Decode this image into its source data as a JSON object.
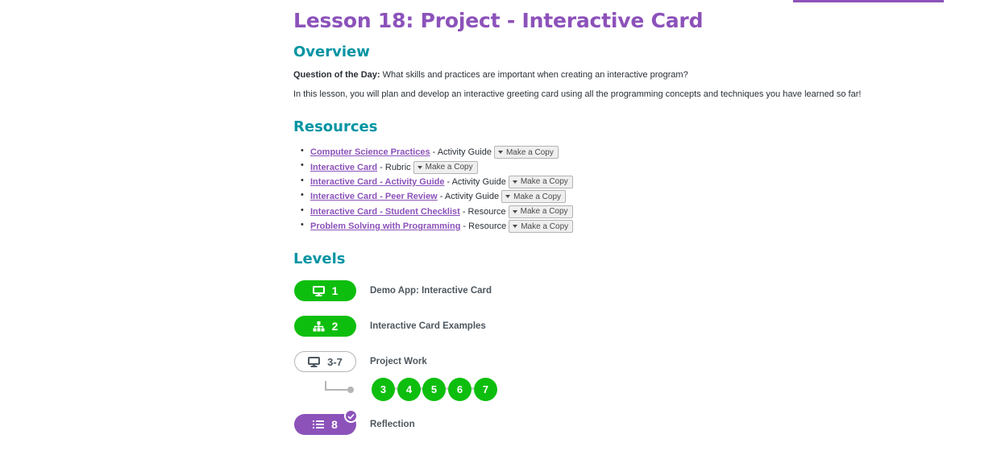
{
  "lesson": {
    "title": "Lesson 18: Project - Interactive Card"
  },
  "overview": {
    "heading": "Overview",
    "qotd_label": "Question of the Day:",
    "qotd_text": " What skills and practices are important when creating an interactive program?",
    "description": "In this lesson, you will plan and develop an interactive greeting card using all the programming concepts and techniques you have learned so far!"
  },
  "resources": {
    "heading": "Resources",
    "copy_label": "Make a Copy",
    "items": [
      {
        "link": "Computer Science Practices",
        "type": "- Activity Guide"
      },
      {
        "link": "Interactive Card",
        "type": "- Rubric"
      },
      {
        "link": "Interactive Card - Activity Guide",
        "type": "- Activity Guide"
      },
      {
        "link": "Interactive Card - Peer Review",
        "type": "- Activity Guide"
      },
      {
        "link": "Interactive Card - Student Checklist",
        "type": "- Resource"
      },
      {
        "link": "Problem Solving with Programming",
        "type": "- Resource"
      }
    ]
  },
  "levels": {
    "heading": "Levels",
    "items": [
      {
        "number": "1",
        "name": "Demo App: Interactive Card",
        "icon": "desktop-icon",
        "style": "green"
      },
      {
        "number": "2",
        "name": "Interactive Card Examples",
        "icon": "sitemap-icon",
        "style": "green"
      },
      {
        "number": "3-7",
        "name": "Project Work",
        "icon": "desktop-icon",
        "style": "outline"
      },
      {
        "number": "8",
        "name": "Reflection",
        "icon": "list-icon",
        "style": "purple",
        "completed": true
      }
    ],
    "sublevels": [
      "3",
      "4",
      "5",
      "6",
      "7"
    ]
  },
  "colors": {
    "brand_purple": "#8c52ba",
    "heading_teal": "#0094a3",
    "level_green": "#0ebe0e"
  }
}
